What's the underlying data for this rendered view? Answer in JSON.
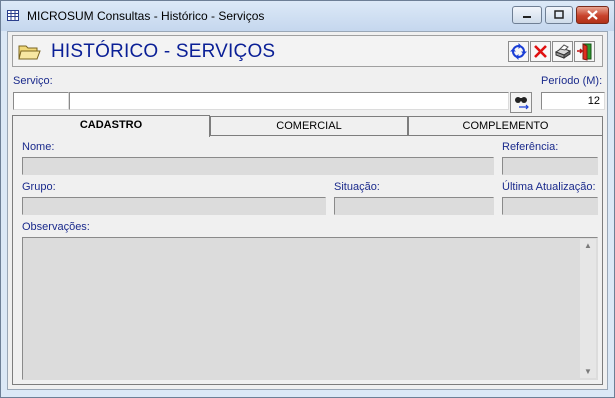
{
  "window": {
    "title": "MICROSUM Consultas - Histórico - Serviços"
  },
  "header": {
    "title": "HISTÓRICO - SERVIÇOS"
  },
  "toolbar": {
    "icons": [
      "refresh-icon",
      "delete-icon",
      "print-icon",
      "exit-door-icon"
    ]
  },
  "filters": {
    "servico_label": "Serviço:",
    "servico_code": "",
    "servico_desc": "",
    "periodo_label": "Período (M):",
    "periodo_value": "12"
  },
  "tabs": [
    {
      "label": "CADASTRO",
      "active": true
    },
    {
      "label": "COMERCIAL",
      "active": false
    },
    {
      "label": "COMPLEMENTO",
      "active": false
    }
  ],
  "cadastro": {
    "nome_label": "Nome:",
    "nome_value": "",
    "referencia_label": "Referência:",
    "referencia_value": "",
    "grupo_label": "Grupo:",
    "grupo_value": "",
    "situacao_label": "Situação:",
    "situacao_value": "",
    "ultima_atualizacao_label": "Última Atualização:",
    "ultima_atualizacao_value": "",
    "observacoes_label": "Observações:",
    "observacoes_value": ""
  },
  "colors": {
    "title_blue": "#0a1f96",
    "label_blue": "#1a2a8c",
    "disabled_field": "#dcdcdc"
  }
}
